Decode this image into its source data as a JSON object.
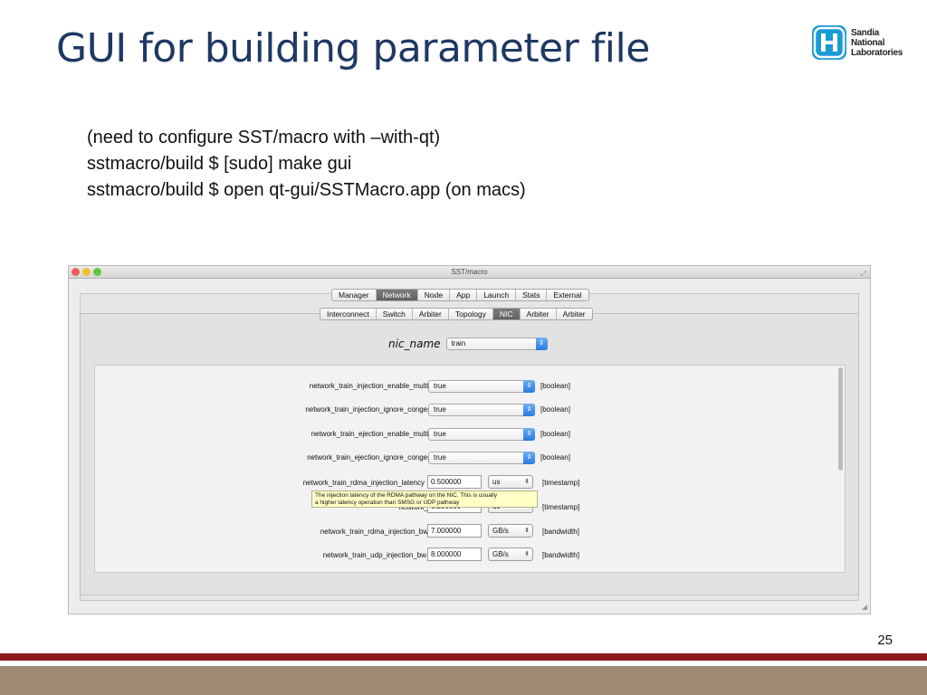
{
  "slide": {
    "title": "GUI for building parameter file",
    "page_number": "25",
    "instructions": [
      "(need to configure SST/macro with –with-qt)",
      "sstmacro/build $ [sudo] make gui",
      "sstmacro/build $ open qt-gui/SSTMacro.app  (on macs)"
    ]
  },
  "logo": {
    "lines": [
      "Sandia",
      "National",
      "Laboratories"
    ],
    "icon": "sandia-logo-icon",
    "color": "#1a9bd7"
  },
  "colors": {
    "title": "#1f3864",
    "footer_line": "#8c1a1f",
    "footer_band": "#a08b77",
    "tooltip_bg": "#ffffc6"
  },
  "window": {
    "title": "SST/macro",
    "main_tabs": [
      "Manager",
      "Network",
      "Node",
      "App",
      "Launch",
      "Stats",
      "External"
    ],
    "main_active": "Network",
    "sub_tabs": [
      "Interconnect",
      "Switch",
      "Arbiter",
      "Topology",
      "NIC",
      "Arbiter",
      "Arbiter"
    ],
    "sub_active": "NIC",
    "nic_name": {
      "label": "nic_name",
      "value": "train"
    },
    "params": [
      {
        "label": "network_train_injection_enable_multipath",
        "value": "true",
        "type": "[boolean]"
      },
      {
        "label": "network_train_injection_ignore_congestion",
        "value": "true",
        "type": "[boolean]"
      },
      {
        "label": "network_train_ejection_enable_multipath",
        "value": "true",
        "type": "[boolean]"
      },
      {
        "label": "network_train_ejection_ignore_congestion",
        "value": "true",
        "type": "[boolean]"
      },
      {
        "label": "network_train_rdma_injection_latency",
        "value": "0.500000",
        "unit": "us",
        "type": "[timestamp]"
      },
      {
        "label": "network_t",
        "value": "0.200000",
        "unit": "us",
        "type": "[timestamp]"
      },
      {
        "label": "network_train_rdma_injection_bw",
        "value": "7.000000",
        "unit": "GB/s",
        "type": "[bandwidth]"
      },
      {
        "label": "network_train_udp_injection_bw",
        "value": "8.000000",
        "unit": "GB/s",
        "type": "[bandwidth]"
      }
    ],
    "tooltip": [
      "The injection latency of the RDMA pathway on the NIC. This is usually",
      "a higher latency operation than SMSG or UDP pathway"
    ]
  }
}
